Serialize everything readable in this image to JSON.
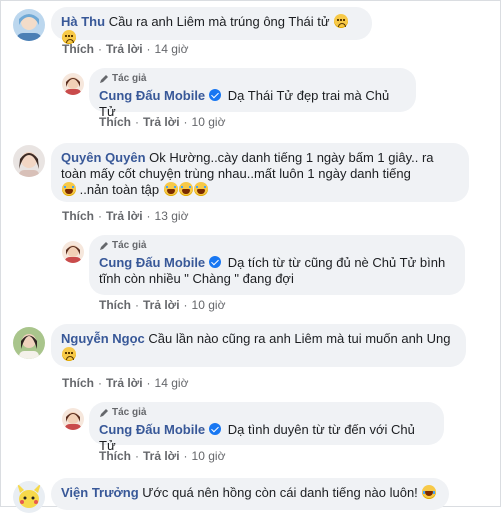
{
  "labels": {
    "like": "Thích",
    "reply": "Trả lời",
    "separator": "·",
    "author_badge": "Tác giả"
  },
  "comments": [
    {
      "name": "Hà Thu",
      "text": "Cầu ra anh Liêm mà trúng ông Thái tử",
      "emojis": [
        "sad-face",
        "sad-face"
      ],
      "time": "14 giờ",
      "reply": {
        "name": "Cung Đấu Mobile",
        "text": "Dạ Thái Tử đẹp trai mà Chủ Tử",
        "time": "10 giờ"
      }
    },
    {
      "name": "Quyên Quyên",
      "text_line1": "Ok Hường..cày danh tiếng 1 ngày bấm 1 giây.. ra",
      "text_line2": "toàn mấy cốt chuyện trùng nhau..mất luôn 1 ngày danh tiếng",
      "text_line3": "..nản toàn tập",
      "emojis": [
        "crying-face",
        "crying-face",
        "crying-face",
        "crying-face"
      ],
      "time": "13 giờ",
      "reply": {
        "name": "Cung Đấu Mobile",
        "text_line1": "Dạ tích từ từ cũng đủ nè Chủ Tử bình",
        "text_line2": "tĩnh còn nhiều \" Chàng \" đang đợi",
        "time": "10 giờ"
      }
    },
    {
      "name": "Nguyễn Ngọc",
      "text": "Cầu lần nào cũng ra anh Liêm mà tui muốn anh Ung",
      "emojis": [
        "sad-face"
      ],
      "time": "14 giờ",
      "reply": {
        "name": "Cung Đấu Mobile",
        "text": "Dạ tình duyên từ từ đến với Chủ Tử",
        "time": "10 giờ"
      }
    },
    {
      "name": "Viện Trưởng",
      "text": "Ước quá nên hồng còn cái danh tiếng nào luôn!",
      "emojis": [
        "laughing-face"
      ]
    }
  ],
  "colors": {
    "name": "#385898",
    "meta": "#65676b",
    "bubble": "#f0f2f5",
    "verified": "#1877f2"
  }
}
